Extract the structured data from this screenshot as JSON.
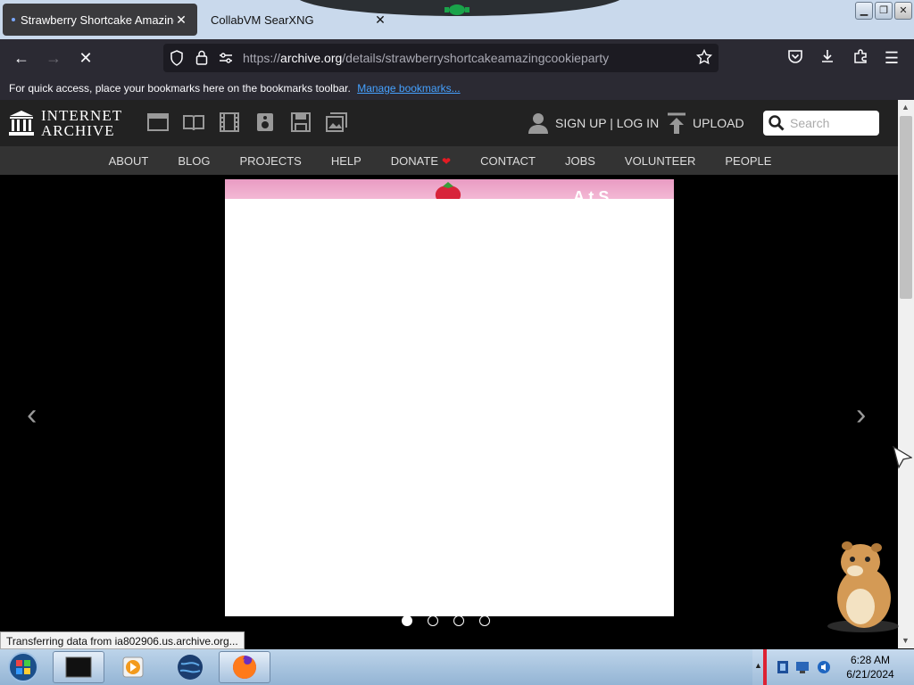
{
  "browser": {
    "tabs": [
      {
        "title": "Strawberry Shortcake Amazing",
        "active": true
      },
      {
        "title": "CollabVM SearXNG",
        "active": false
      }
    ],
    "url": {
      "scheme": "https://",
      "host": "archive.org",
      "path": "/details/strawberryshortcakeamazingcookieparty"
    },
    "bookmarks_bar": {
      "text": "For quick access, place your bookmarks here on the bookmarks toolbar.",
      "link": "Manage bookmarks..."
    }
  },
  "ia": {
    "logo": {
      "line1": "INTERNET",
      "line2": "ARCHIVE"
    },
    "media_icons": [
      "web-icon",
      "book-icon",
      "film-icon",
      "audio-icon",
      "software-icon",
      "image-icon"
    ],
    "account": "SIGN UP | LOG IN",
    "upload": "UPLOAD",
    "search_placeholder": "Search",
    "nav": [
      "ABOUT",
      "BLOG",
      "PROJECTS",
      "HELP",
      "DONATE",
      "CONTACT",
      "JOBS",
      "VOLUNTEER",
      "PEOPLE"
    ],
    "viewer": {
      "banner_text": "A    t  S",
      "pages": 4,
      "current_page": 1
    }
  },
  "status_text": "Transferring data from ia802906.us.archive.org...",
  "clock": {
    "time": "6:28 AM",
    "date": "6/21/2024"
  }
}
